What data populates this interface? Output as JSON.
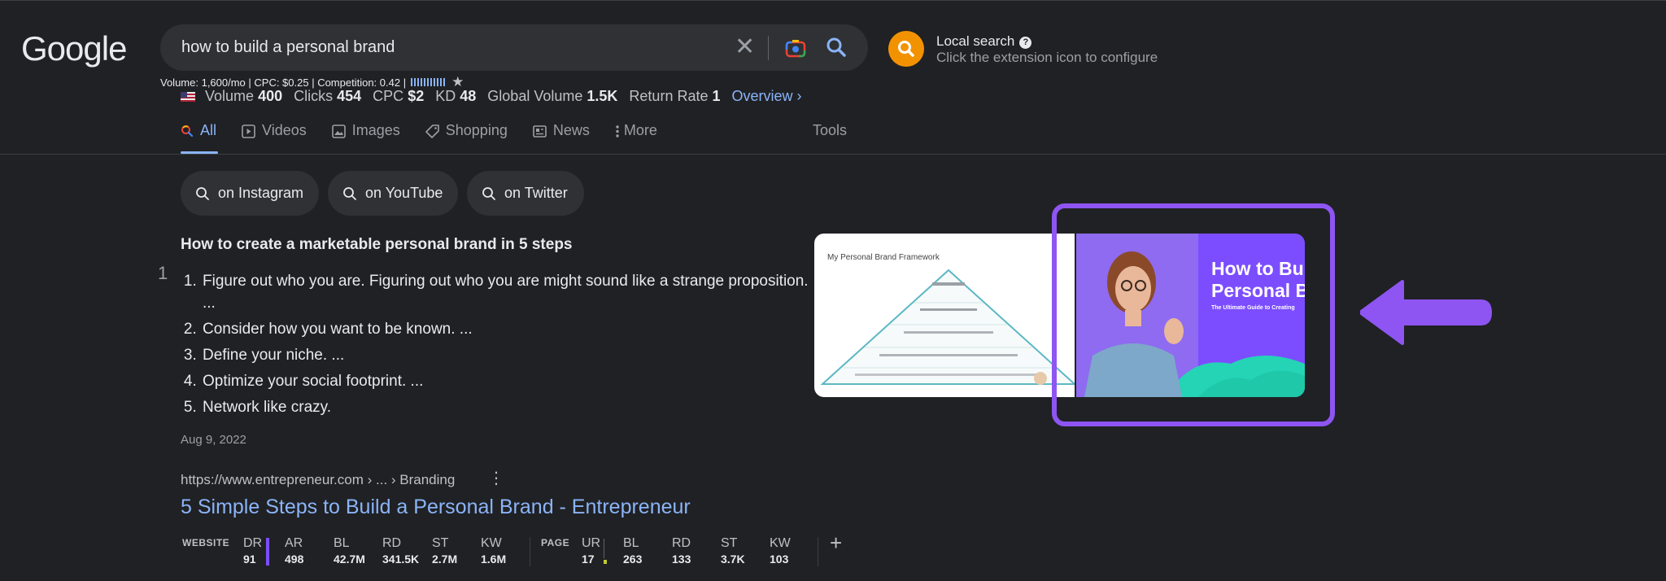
{
  "logo": "Google",
  "search": {
    "query": "how to build a personal brand",
    "clear_icon": "close-icon",
    "lens_icon": "camera-lens-icon",
    "search_icon": "search-icon"
  },
  "extension": {
    "icon": "search-icon",
    "title": "Local search",
    "help": "?",
    "subtitle": "Click the extension icon to configure",
    "accent": "#f39200"
  },
  "volume_line": "Volume: 1,600/mo | CPC: $0.25 | Competition: 0.42 |",
  "metrics": {
    "volume_label": "Volume",
    "volume": "400",
    "clicks_label": "Clicks",
    "clicks": "454",
    "cpc_label": "CPC",
    "cpc": "$2",
    "kd_label": "KD",
    "kd": "48",
    "global_label": "Global Volume",
    "global": "1.5K",
    "return_label": "Return Rate",
    "return": "1",
    "overview": "Overview ›"
  },
  "tabs": [
    {
      "label": "All",
      "icon": "search-icon"
    },
    {
      "label": "Videos",
      "icon": "play-icon"
    },
    {
      "label": "Images",
      "icon": "image-icon"
    },
    {
      "label": "Shopping",
      "icon": "tag-icon"
    },
    {
      "label": "News",
      "icon": "news-icon"
    },
    {
      "label": "More",
      "icon": "more-vert-icon"
    }
  ],
  "tools": "Tools",
  "chips": [
    "on Instagram",
    "on YouTube",
    "on Twitter"
  ],
  "snippet": {
    "rank": "1",
    "title": "How to create a marketable personal brand in 5 steps",
    "steps": [
      "Figure out who you are. Figuring out who you are might sound like a strange proposition. ...",
      "Consider how you want to be known. ...",
      "Define your niche. ...",
      "Optimize your social footprint. ...",
      "Network like crazy."
    ],
    "date": "Aug 9, 2022"
  },
  "images": {
    "left_title": "My Personal Brand Framework",
    "right_title": "How to Bu Personal B",
    "right_sub": "The Ultimate Guide to Creating",
    "accent": "#7c4dff"
  },
  "result": {
    "url": "https://www.entrepreneur.com › ... › Branding",
    "title": "5 Simple Steps to Build a Personal Brand - Entrepreneur"
  },
  "seo": {
    "website_label": "WEBSITE",
    "page_label": "PAGE",
    "website": [
      {
        "k": "DR",
        "v": "91"
      },
      {
        "k": "AR",
        "v": "498"
      },
      {
        "k": "BL",
        "v": "42.7M"
      },
      {
        "k": "RD",
        "v": "341.5K"
      },
      {
        "k": "ST",
        "v": "2.7M"
      },
      {
        "k": "KW",
        "v": "1.6M"
      }
    ],
    "page": [
      {
        "k": "UR",
        "v": "17"
      },
      {
        "k": "BL",
        "v": "263"
      },
      {
        "k": "RD",
        "v": "133"
      },
      {
        "k": "ST",
        "v": "3.7K"
      },
      {
        "k": "KW",
        "v": "103"
      }
    ],
    "plus": "+"
  },
  "annotation_color": "#8e55f2"
}
